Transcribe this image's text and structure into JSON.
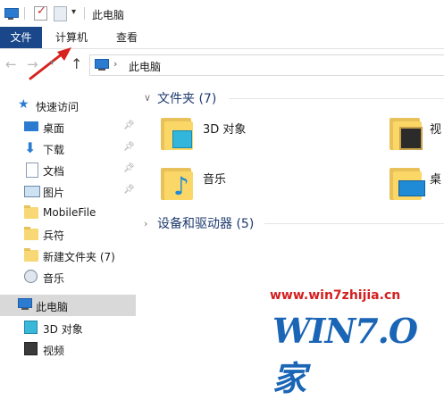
{
  "window": {
    "title": "此电脑"
  },
  "ribbon": {
    "tabs": [
      {
        "label": "文件"
      },
      {
        "label": "计算机"
      },
      {
        "label": "查看"
      }
    ]
  },
  "address": {
    "path": "此电脑"
  },
  "sidebar": {
    "quick_access": "快速访问",
    "items": [
      {
        "label": "桌面",
        "icon": "desktop-icon",
        "pinned": true
      },
      {
        "label": "下载",
        "icon": "download-icon",
        "pinned": true
      },
      {
        "label": "文档",
        "icon": "document-icon",
        "pinned": true
      },
      {
        "label": "图片",
        "icon": "picture-icon",
        "pinned": true
      },
      {
        "label": "MobileFile",
        "icon": "folder-icon",
        "pinned": false
      },
      {
        "label": "兵符",
        "icon": "folder-icon",
        "pinned": false
      },
      {
        "label": "新建文件夹 (7)",
        "icon": "folder-icon",
        "pinned": false
      },
      {
        "label": "音乐",
        "icon": "music-icon",
        "pinned": false
      }
    ],
    "this_pc": "此电脑",
    "this_pc_children": [
      {
        "label": "3D 对象",
        "icon": "3d-objects-icon"
      },
      {
        "label": "视频",
        "icon": "video-icon"
      }
    ]
  },
  "content": {
    "folders_header": "文件夹 (7)",
    "folders": [
      {
        "label": "3D 对象",
        "icon": "3d-objects-icon"
      },
      {
        "label": "视",
        "icon": "video-icon"
      },
      {
        "label": "音乐",
        "icon": "music-icon"
      },
      {
        "label": "桌",
        "icon": "desktop-icon"
      }
    ],
    "devices_header": "设备和驱动器 (5)"
  },
  "watermark": {
    "url": "www.win7zhijia.cn",
    "logo_text": "WIN7.O家"
  },
  "colors": {
    "file_tab": "#19478a",
    "accent": "#1e3a6e",
    "watermark_red": "#d42020",
    "watermark_blue": "#1b65b6"
  }
}
